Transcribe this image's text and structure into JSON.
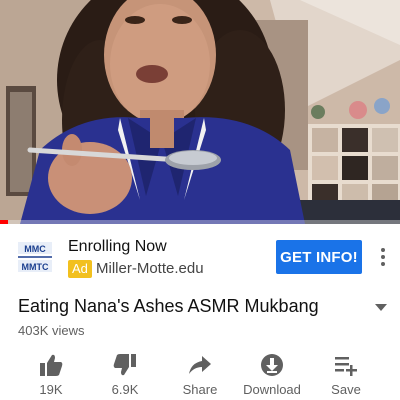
{
  "video": {
    "progress": 0.02
  },
  "ad": {
    "logo_text_top": "MMC",
    "logo_text_bottom": "MMTC",
    "title": "Enrolling Now",
    "badge": "Ad",
    "domain": "Miller-Motte.edu",
    "cta": "GET INFO!"
  },
  "video_info": {
    "title": "Eating Nana's Ashes ASMR Mukbang",
    "views": "403K views"
  },
  "actions": [
    {
      "label": "19K",
      "icon": "thumbs-up-icon"
    },
    {
      "label": "6.9K",
      "icon": "thumbs-down-icon"
    },
    {
      "label": "Share",
      "icon": "share-icon"
    },
    {
      "label": "Download",
      "icon": "download-icon"
    },
    {
      "label": "Save",
      "icon": "add-to-playlist-icon"
    }
  ],
  "colors": {
    "progress": "#ff0000",
    "cta": "#1a73e8",
    "ad_badge": "#f2c01e",
    "secondary_text": "#606060"
  }
}
